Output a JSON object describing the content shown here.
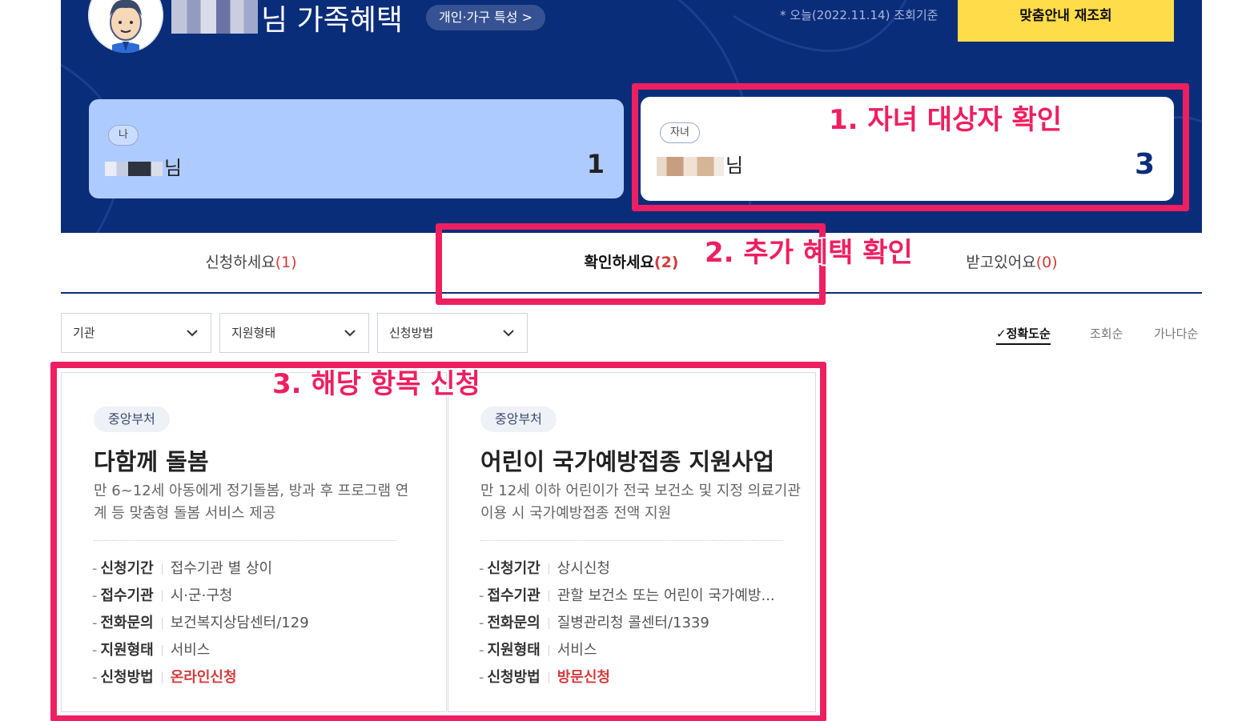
{
  "header": {
    "title_suffix": "님 가족혜택",
    "trait_button": "개인·가구 특성 >",
    "date_note": "* 오늘(2022.11.14) 조회기준",
    "requery_button": "맞춤안내 재조회"
  },
  "members": [
    {
      "tag": "나",
      "name_suffix": "님",
      "count": "1"
    },
    {
      "tag": "자녀",
      "name_suffix": "님",
      "count": "3"
    }
  ],
  "tabs": [
    {
      "label": "신청하세요",
      "count": "(1)"
    },
    {
      "label": "확인하세요",
      "count": "(2)"
    },
    {
      "label": "받고있어요",
      "count": "(0)"
    }
  ],
  "filters": [
    "기관",
    "지원형태",
    "신청방법"
  ],
  "sort": [
    {
      "label": "정확도순",
      "active": true
    },
    {
      "label": "조회순"
    },
    {
      "label": "가나다순"
    }
  ],
  "benefits": [
    {
      "tag": "중앙부처",
      "title": "다함께 돌봄",
      "desc": "만 6~12세 아동에게 정기돌봄, 방과 후 프로그램 연계 등 맞춤형 돌봄 서비스 제공",
      "rows": [
        {
          "label": "신청기간",
          "value": "접수기관 별 상이"
        },
        {
          "label": "접수기관",
          "value": "시·군·구청"
        },
        {
          "label": "전화문의",
          "value": "보건복지상담센터/129"
        },
        {
          "label": "지원형태",
          "value": "서비스"
        },
        {
          "label": "신청방법",
          "value": "온라인신청"
        }
      ]
    },
    {
      "tag": "중앙부처",
      "title": "어린이 국가예방접종 지원사업",
      "desc": "만 12세 이하 어린이가 전국 보건소 및 지정 의료기관 이용 시 국가예방접종 전액 지원",
      "rows": [
        {
          "label": "신청기간",
          "value": "상시신청"
        },
        {
          "label": "접수기관",
          "value": "관할 보건소 또는 어린이 국가예방..."
        },
        {
          "label": "전화문의",
          "value": "질병관리청 콜센터/1339"
        },
        {
          "label": "지원형태",
          "value": "서비스"
        },
        {
          "label": "신청방법",
          "value": "방문신청"
        }
      ]
    }
  ],
  "annotations": [
    "1. 자녀 대상자 확인",
    "2. 추가 혜택 확인",
    "3. 해당 항목 신청"
  ],
  "colors": {
    "banner": "#0a2d7a",
    "accent_yellow": "#ffdc4a",
    "highlight": "#ee1f61",
    "count_red": "#d23b3b"
  }
}
